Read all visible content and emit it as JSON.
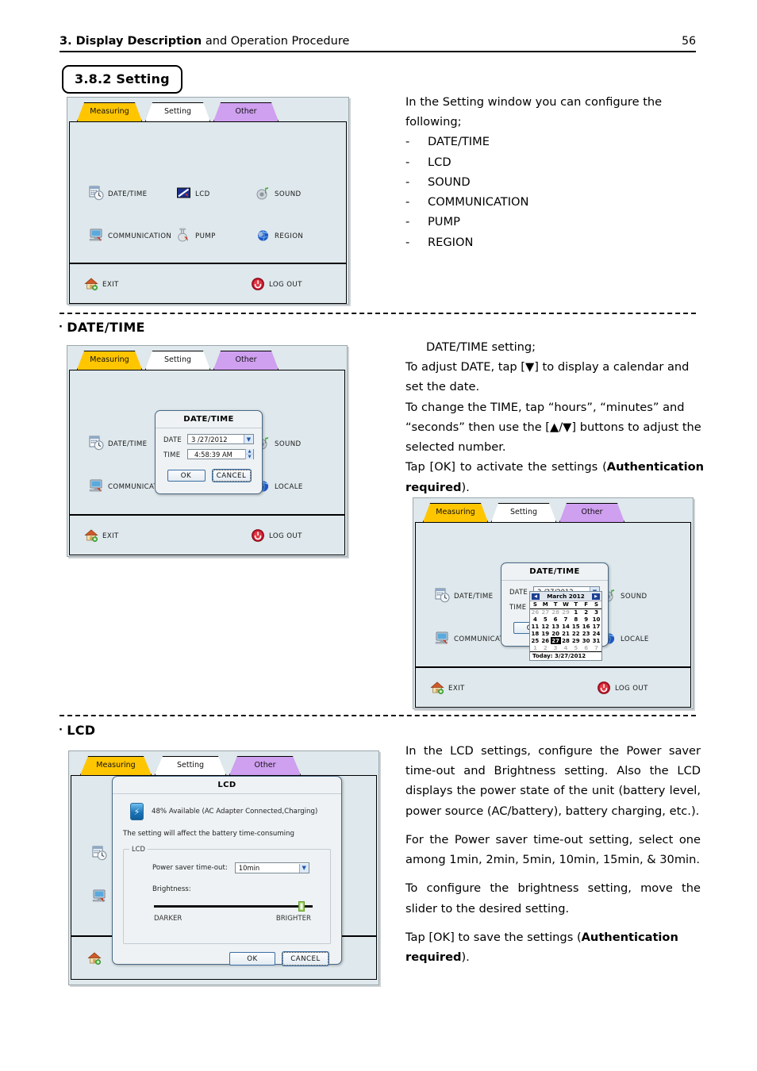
{
  "header": {
    "title_bold": "3. Display Description",
    "title_rest": " and Operation Procedure",
    "page_number": "56"
  },
  "section": {
    "number_title": "3.8.2 Setting"
  },
  "setting_screen": {
    "tabs": [
      {
        "label": "Measuring",
        "color": "#ffc600",
        "active": false
      },
      {
        "label": "Setting",
        "color": "#ffffff",
        "active": true
      },
      {
        "label": "Other",
        "color": "#cf9ff0",
        "active": false
      }
    ],
    "menu": [
      {
        "label": "DATE/TIME",
        "icon": "calendar-clock-icon"
      },
      {
        "label": "LCD",
        "icon": "lcd-screen-icon"
      },
      {
        "label": "SOUND",
        "icon": "speaker-icon"
      },
      {
        "label": "COMMUNICATION",
        "icon": "monitor-network-icon"
      },
      {
        "label": "PUMP",
        "icon": "pump-icon"
      },
      {
        "label": "REGION",
        "icon": "globe-icon"
      }
    ],
    "footer": [
      {
        "label": "EXIT",
        "icon": "home-icon"
      },
      {
        "label": "LOG OUT",
        "icon": "power-icon"
      }
    ]
  },
  "setting_text": {
    "intro_line1": "In the Setting window you can configure the",
    "intro_line2": "following;",
    "dash": "-",
    "items": [
      "DATE/TIME",
      "LCD",
      "SOUND",
      "COMMUNICATION",
      "PUMP",
      "REGION"
    ]
  },
  "datetime_section": {
    "heading": "DATE/TIME",
    "bullet": "·",
    "paragraphs": [
      "DATE/TIME setting;",
      "To adjust DATE, tap [▼] to display a calendar and set the date.",
      "To change the TIME, tap “hours”, “minutes” and “seconds” then use the [▲/▼] buttons to adjust the selected number."
    ],
    "tap_ok_prefix": "Tap [OK] to activate the settings (",
    "tap_ok_bold": "Authentication required",
    "tap_ok_suffix": ")."
  },
  "datetime_screen": {
    "menu": [
      {
        "label": "DATE/TIME",
        "icon": "calendar-clock-icon"
      },
      {
        "label": "SOUND",
        "icon": "speaker-icon"
      },
      {
        "label": "COMMUNICAT",
        "icon": "monitor-network-icon"
      },
      {
        "label": "LOCALE",
        "icon": "globe-icon"
      }
    ],
    "dialog": {
      "title": "DATE/TIME",
      "date_label": "DATE",
      "date_value": "3 /27/2012",
      "time_label": "TIME",
      "time_value": "4:58:39 AM",
      "ok": "OK",
      "cancel": "CANCEL"
    },
    "footer": [
      {
        "label": "EXIT",
        "icon": "home-icon"
      },
      {
        "label": "LOG OUT",
        "icon": "power-icon"
      }
    ]
  },
  "calendar": {
    "month_year": "March 2012",
    "prev": "◀",
    "next": "▶",
    "weekdays": [
      "S",
      "M",
      "T",
      "W",
      "T",
      "F",
      "S"
    ],
    "weeks": [
      [
        {
          "d": "26",
          "dim": true
        },
        {
          "d": "27",
          "dim": true
        },
        {
          "d": "28",
          "dim": true
        },
        {
          "d": "29",
          "dim": true
        },
        {
          "d": "1"
        },
        {
          "d": "2"
        },
        {
          "d": "3"
        }
      ],
      [
        {
          "d": "4"
        },
        {
          "d": "5"
        },
        {
          "d": "6"
        },
        {
          "d": "7"
        },
        {
          "d": "8"
        },
        {
          "d": "9"
        },
        {
          "d": "10"
        }
      ],
      [
        {
          "d": "11"
        },
        {
          "d": "12"
        },
        {
          "d": "13"
        },
        {
          "d": "14"
        },
        {
          "d": "15"
        },
        {
          "d": "16"
        },
        {
          "d": "17"
        }
      ],
      [
        {
          "d": "18"
        },
        {
          "d": "19"
        },
        {
          "d": "20"
        },
        {
          "d": "21"
        },
        {
          "d": "22"
        },
        {
          "d": "23"
        },
        {
          "d": "24"
        }
      ],
      [
        {
          "d": "25"
        },
        {
          "d": "26"
        },
        {
          "d": "27",
          "sel": true
        },
        {
          "d": "28"
        },
        {
          "d": "29"
        },
        {
          "d": "30"
        },
        {
          "d": "31"
        }
      ],
      [
        {
          "d": "1",
          "dim": true
        },
        {
          "d": "2",
          "dim": true
        },
        {
          "d": "3",
          "dim": true
        },
        {
          "d": "4",
          "dim": true
        },
        {
          "d": "5",
          "dim": true
        },
        {
          "d": "6",
          "dim": true
        },
        {
          "d": "7",
          "dim": true
        }
      ]
    ],
    "today": "Today: 3/27/2012"
  },
  "lcd_section": {
    "heading": "LCD",
    "bullet": "·",
    "para1": "In the LCD settings, configure the Power saver time-out and Brightness setting. Also the LCD displays the power state of the unit (battery level, power source (AC/battery), battery charging, etc.).",
    "para2": "For the Power saver time-out setting, select one among 1min, 2min, 5min, 10min, 15min, & 30min.",
    "para3": "To configure the brightness setting, move the slider to the desired setting.",
    "para4_prefix": "Tap [OK] to save the settings (",
    "para4_bold": "Authentication required",
    "para4_suffix": ")."
  },
  "lcd_screen": {
    "dialog": {
      "title": "LCD",
      "battery_status": "48% Available   (AC Adapter Connected,Charging)",
      "note": "The setting will affect the battery time-consuming",
      "group_legend": "LCD",
      "power_saver_label": "Power saver time-out:",
      "power_saver_value": "10min",
      "power_saver_options": [
        "1min",
        "2min",
        "5min",
        "10min",
        "15min",
        "30min"
      ],
      "brightness_label": "Brightness:",
      "darker": "DARKER",
      "brighter": "BRIGHTER",
      "brightness_percent": 93,
      "ok": "OK",
      "cancel": "CANCEL"
    }
  }
}
